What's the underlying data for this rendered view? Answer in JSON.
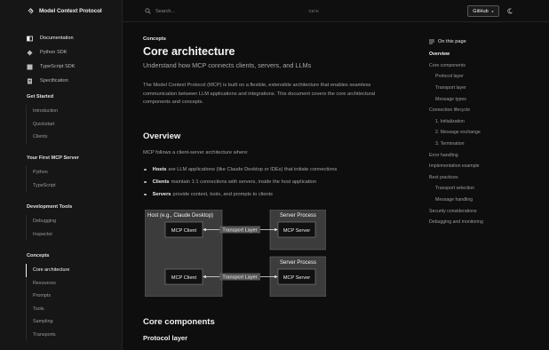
{
  "brand": {
    "name": "Model Context Protocol",
    "logo_icon": "mcp-logo-icon"
  },
  "sidebar": {
    "top_links": [
      {
        "label": "Documentation",
        "icon": "book-icon",
        "active": true
      },
      {
        "label": "Python SDK",
        "icon": "python-icon",
        "active": false
      },
      {
        "label": "TypeScript SDK",
        "icon": "typescript-icon",
        "active": false
      },
      {
        "label": "Specification",
        "icon": "document-icon",
        "active": false
      }
    ],
    "sections": [
      {
        "title": "Get Started",
        "items": [
          "Introduction",
          "Quickstart",
          "Clients"
        ]
      },
      {
        "title": "Your First MCP Server",
        "items": [
          "Python",
          "TypeScript"
        ]
      },
      {
        "title": "Development Tools",
        "items": [
          "Debugging",
          "Inspector"
        ]
      },
      {
        "title": "Concepts",
        "items": [
          "Core architecture",
          "Resources",
          "Prompts",
          "Tools",
          "Sampling",
          "Transports"
        ],
        "active_index": 0
      }
    ]
  },
  "topbar": {
    "search_placeholder": "Search...",
    "search_shortcut": "Ctrl K",
    "github_label": "GitHub",
    "github_icon": "chevron-right-icon",
    "theme_icon": "moon-icon"
  },
  "main": {
    "eyebrow": "Concepts",
    "title": "Core architecture",
    "subtitle": "Understand how MCP connects clients, servers, and LLMs",
    "intro": "The Model Context Protocol (MCP) is built on a flexible, extensible architecture that enables seamless communication between LLM applications and integrations. This document covers the core architectural components and concepts.",
    "overview": {
      "heading": "Overview",
      "lead": "MCP follows a client-server architecture where:",
      "bullets": [
        {
          "term": "Hosts",
          "text": "are LLM applications (like Claude Desktop or IDEs) that initiate connections"
        },
        {
          "term": "Clients",
          "text": "maintain 1:1 connections with servers, inside the host application"
        },
        {
          "term": "Servers",
          "text": "provide context, tools, and prompts to clients"
        }
      ]
    },
    "diagram": {
      "host_label": "Host (e.g., Claude Desktop)",
      "client_label": "MCP Client",
      "server_process_label": "Server Process",
      "server_label": "MCP Server",
      "transport_label": "Transport Layer"
    },
    "core_components": {
      "heading": "Core components",
      "sub": "Protocol layer"
    }
  },
  "toc": {
    "heading": "On this page",
    "icon": "list-icon",
    "items": [
      {
        "label": "Overview",
        "level": 0,
        "active": true
      },
      {
        "label": "Core components",
        "level": 0
      },
      {
        "label": "Protocol layer",
        "level": 1
      },
      {
        "label": "Transport layer",
        "level": 1
      },
      {
        "label": "Message types",
        "level": 1
      },
      {
        "label": "Connection lifecycle",
        "level": 0
      },
      {
        "label": "1. Initialization",
        "level": 1
      },
      {
        "label": "2. Message exchange",
        "level": 1
      },
      {
        "label": "3. Termination",
        "level": 1
      },
      {
        "label": "Error handling",
        "level": 0
      },
      {
        "label": "Implementation example",
        "level": 0
      },
      {
        "label": "Best practices",
        "level": 0
      },
      {
        "label": "Transport selection",
        "level": 1
      },
      {
        "label": "Message handling",
        "level": 1
      },
      {
        "label": "Security considerations",
        "level": 0
      },
      {
        "label": "Debugging and monitoring",
        "level": 0
      }
    ]
  }
}
